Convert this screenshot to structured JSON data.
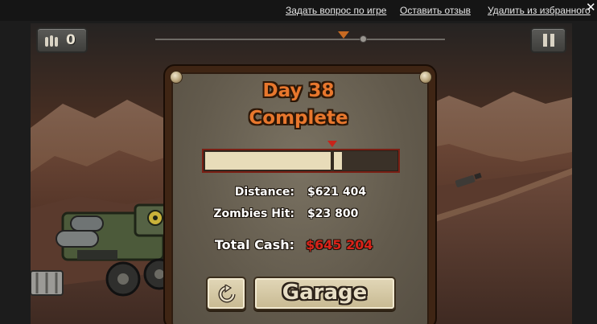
{
  "top_links": {
    "ask_question": "Задать вопрос по игре",
    "leave_review": "Оставить отзыв",
    "remove_favorite": "Удалить из избранного",
    "close_symbol": "✕"
  },
  "hud": {
    "ammo_count": "0",
    "ammo_icon": "bullets-icon",
    "pause_icon": "pause-icon",
    "level_progress": 0.65
  },
  "result": {
    "title_line1": "Day 38",
    "title_line2": "Complete",
    "progress_fraction": 0.66,
    "stats": {
      "distance_label": "Distance:",
      "distance_value": "$621 404",
      "zombies_label": "Zombies Hit:",
      "zombies_value": "$23 800",
      "total_label": "Total Cash:",
      "total_value": "$645 204"
    },
    "replay_icon": "replay-icon",
    "garage_label": "Garage"
  },
  "colors": {
    "title": "#e8772d",
    "total_cash": "#d8231a",
    "panel_frame": "#3f2514",
    "panel_fill": "#6b6253",
    "bar_fill": "#e8dcb9",
    "bar_border": "#7a1f14"
  }
}
